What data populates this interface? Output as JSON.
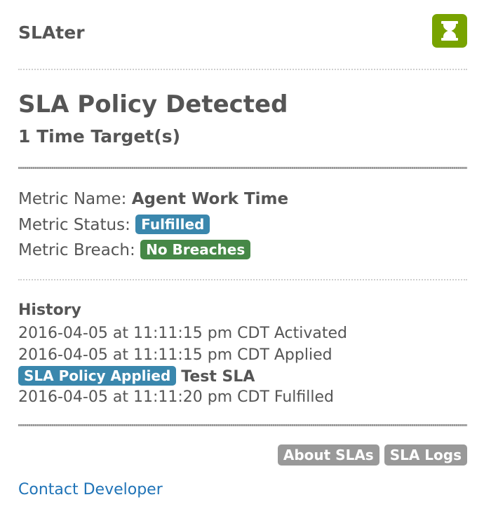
{
  "app": {
    "title": "SLAter",
    "logo_icon": "hourglass-icon",
    "logo_color": "#78a300"
  },
  "policy": {
    "title": "SLA Policy Detected",
    "subtitle": "1 Time Target(s)"
  },
  "metric": {
    "name_label": "Metric Name:",
    "name_value": "Agent Work Time",
    "status_label": "Metric Status:",
    "status_value": "Fulfilled",
    "status_color": "#3a87ad",
    "breach_label": "Metric Breach:",
    "breach_value": "No Breaches",
    "breach_color": "#468847"
  },
  "history": {
    "title": "History",
    "entries": [
      {
        "text": "2016-04-05 at 11:11:15 pm CDT Activated"
      },
      {
        "text": "2016-04-05 at 11:11:15 pm CDT Applied"
      },
      {
        "badge": "SLA Policy Applied",
        "text": "Test SLA"
      },
      {
        "text": "2016-04-05 at 11:11:20 pm CDT Fulfilled"
      }
    ]
  },
  "footer": {
    "about_label": "About SLAs",
    "logs_label": "SLA Logs",
    "contact_label": "Contact Developer",
    "link_color": "#1f73b7"
  }
}
